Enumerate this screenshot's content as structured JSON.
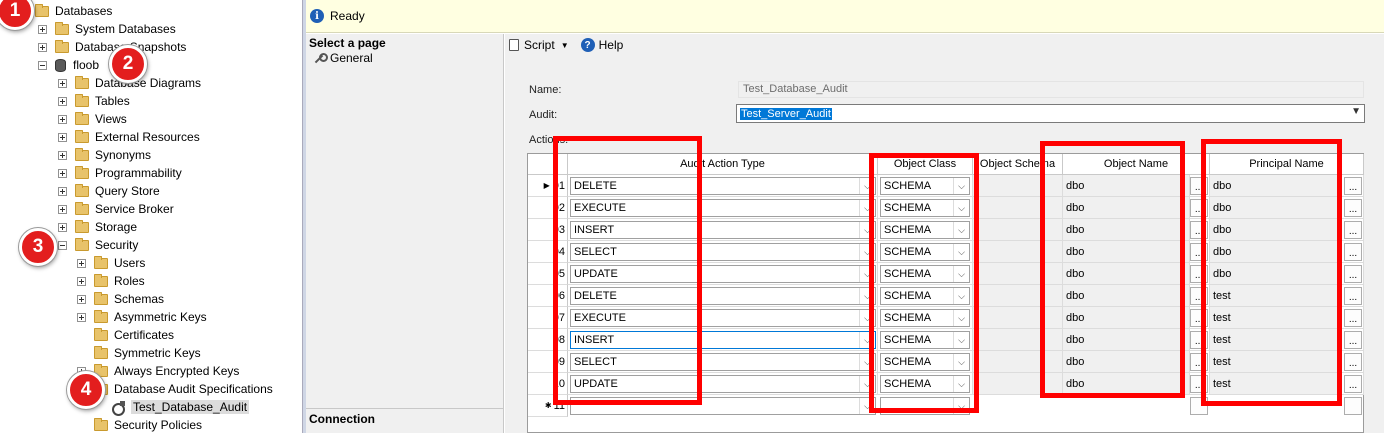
{
  "tree": {
    "nodes": [
      {
        "label": "Databases",
        "indent": 0,
        "expander": "minus",
        "icon": "folder"
      },
      {
        "label": "System Databases",
        "indent": 1,
        "expander": "plus",
        "icon": "folder"
      },
      {
        "label": "Database Snapshots",
        "indent": 1,
        "expander": "plus",
        "icon": "folder"
      },
      {
        "label": "floob",
        "indent": 1,
        "expander": "minus",
        "icon": "database"
      },
      {
        "label": "Database Diagrams",
        "indent": 2,
        "expander": "plus",
        "icon": "folder"
      },
      {
        "label": "Tables",
        "indent": 2,
        "expander": "plus",
        "icon": "folder"
      },
      {
        "label": "Views",
        "indent": 2,
        "expander": "plus",
        "icon": "folder"
      },
      {
        "label": "External Resources",
        "indent": 2,
        "expander": "plus",
        "icon": "folder"
      },
      {
        "label": "Synonyms",
        "indent": 2,
        "expander": "plus",
        "icon": "folder"
      },
      {
        "label": "Programmability",
        "indent": 2,
        "expander": "plus",
        "icon": "folder"
      },
      {
        "label": "Query Store",
        "indent": 2,
        "expander": "plus",
        "icon": "folder"
      },
      {
        "label": "Service Broker",
        "indent": 2,
        "expander": "plus",
        "icon": "folder"
      },
      {
        "label": "Storage",
        "indent": 2,
        "expander": "plus",
        "icon": "folder"
      },
      {
        "label": "Security",
        "indent": 2,
        "expander": "minus",
        "icon": "folder"
      },
      {
        "label": "Users",
        "indent": 3,
        "expander": "plus",
        "icon": "folder"
      },
      {
        "label": "Roles",
        "indent": 3,
        "expander": "plus",
        "icon": "folder"
      },
      {
        "label": "Schemas",
        "indent": 3,
        "expander": "plus",
        "icon": "folder"
      },
      {
        "label": "Asymmetric Keys",
        "indent": 3,
        "expander": "plus",
        "icon": "folder"
      },
      {
        "label": "Certificates",
        "indent": 3,
        "expander": "none",
        "icon": "folder"
      },
      {
        "label": "Symmetric Keys",
        "indent": 3,
        "expander": "none",
        "icon": "folder"
      },
      {
        "label": "Always Encrypted Keys",
        "indent": 3,
        "expander": "plus",
        "icon": "folder"
      },
      {
        "label": "Database Audit Specifications",
        "indent": 3,
        "expander": "minus",
        "icon": "folder"
      },
      {
        "label": "Test_Database_Audit",
        "indent": 4,
        "expander": "none",
        "icon": "audit-spec"
      },
      {
        "label": "Security Policies",
        "indent": 3,
        "expander": "none",
        "icon": "folder"
      }
    ],
    "badges": [
      "1",
      "2",
      "3",
      "4"
    ]
  },
  "status": {
    "text": "Ready"
  },
  "select_page": {
    "title": "Select a page",
    "items": [
      "General"
    ],
    "connection": "Connection"
  },
  "toolbar": {
    "script": "Script",
    "help": "Help"
  },
  "form": {
    "name_label": "Name:",
    "name_value": "Test_Database_Audit",
    "audit_label": "Audit:",
    "audit_value": "Test_Server_Audit",
    "actions_label": "Actions:"
  },
  "grid": {
    "columns": [
      "Audit Action Type",
      "Object Class",
      "Object Schema",
      "Object Name",
      "Principal Name"
    ],
    "rows": [
      {
        "num": "01",
        "action": "DELETE",
        "class": "SCHEMA",
        "schema": "",
        "object": "dbo",
        "principal": "dbo"
      },
      {
        "num": "02",
        "action": "EXECUTE",
        "class": "SCHEMA",
        "schema": "",
        "object": "dbo",
        "principal": "dbo"
      },
      {
        "num": "03",
        "action": "INSERT",
        "class": "SCHEMA",
        "schema": "",
        "object": "dbo",
        "principal": "dbo"
      },
      {
        "num": "04",
        "action": "SELECT",
        "class": "SCHEMA",
        "schema": "",
        "object": "dbo",
        "principal": "dbo"
      },
      {
        "num": "05",
        "action": "UPDATE",
        "class": "SCHEMA",
        "schema": "",
        "object": "dbo",
        "principal": "dbo"
      },
      {
        "num": "06",
        "action": "DELETE",
        "class": "SCHEMA",
        "schema": "",
        "object": "dbo",
        "principal": "test"
      },
      {
        "num": "07",
        "action": "EXECUTE",
        "class": "SCHEMA",
        "schema": "",
        "object": "dbo",
        "principal": "test"
      },
      {
        "num": "08",
        "action": "INSERT",
        "class": "SCHEMA",
        "schema": "",
        "object": "dbo",
        "principal": "test"
      },
      {
        "num": "09",
        "action": "SELECT",
        "class": "SCHEMA",
        "schema": "",
        "object": "dbo",
        "principal": "test"
      },
      {
        "num": "10",
        "action": "UPDATE",
        "class": "SCHEMA",
        "schema": "",
        "object": "dbo",
        "principal": "test"
      }
    ],
    "new_row_num": "11",
    "ellipsis": "...",
    "highlight_color": "#ff0000"
  }
}
